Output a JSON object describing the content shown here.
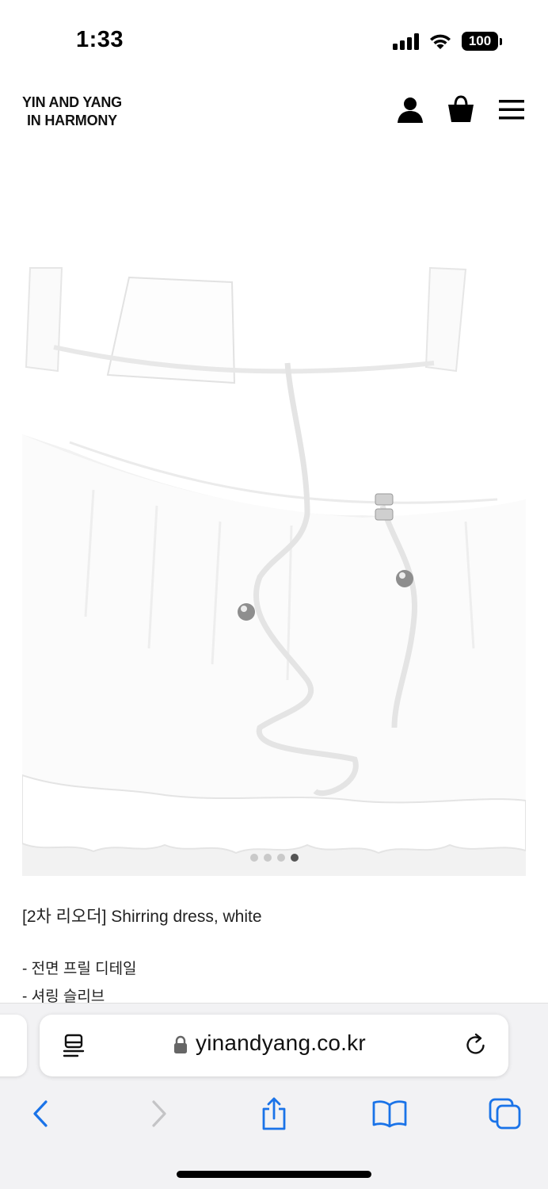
{
  "status_bar": {
    "time": "1:33",
    "battery": "100"
  },
  "header": {
    "logo_line1": "YIN AND YANG",
    "logo_line2": "IN HARMONY",
    "icons": [
      "account-icon",
      "shopping-bag-icon",
      "menu-icon"
    ]
  },
  "product": {
    "image_alt": "white shirring dress detail",
    "carousel": {
      "total": 4,
      "active_index": 4
    },
    "title": "[2차 리오더] Shirring dress, white",
    "details": [
      "- 전면 프릴 디테일",
      "- 셔링 슬리브"
    ]
  },
  "browser": {
    "url": "yinandyang.co.kr",
    "toolbar": [
      "back-icon",
      "forward-icon",
      "share-icon",
      "bookmarks-icon",
      "tabs-icon"
    ]
  },
  "colors": {
    "icon_blue": "#1a73e8",
    "disabled_gray": "#c4c4c6",
    "image_bg": "#efefef"
  }
}
